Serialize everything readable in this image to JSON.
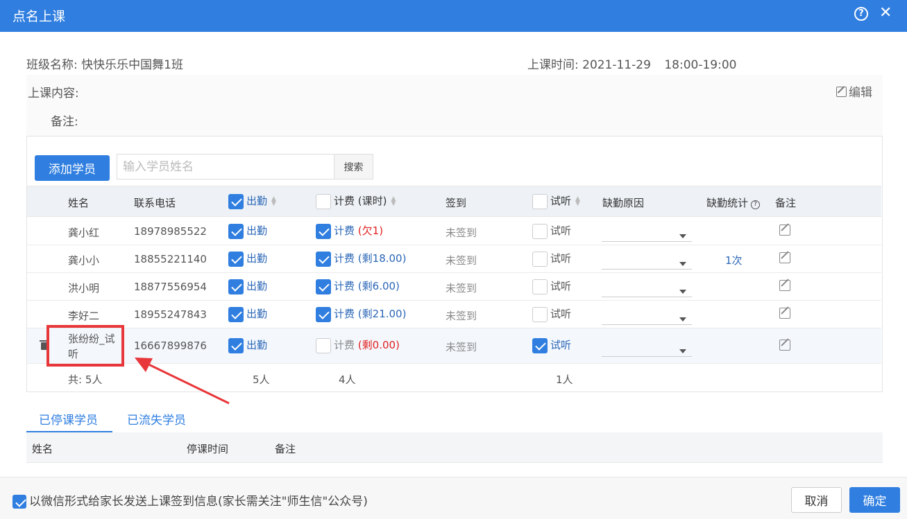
{
  "dialog": {
    "title": "点名上课",
    "help_icon": "question-circle-icon",
    "close_icon": "close-icon"
  },
  "info": {
    "class_label": "班级名称:",
    "class_name": "快快乐乐中国舞1班",
    "time_label": "上课时间:",
    "date": "2021-11-29",
    "time_range": "18:00-19:00",
    "content_label": "上课内容:",
    "remark_label": "备注:",
    "edit_label": "编辑"
  },
  "toolbar": {
    "add_label": "添加学员",
    "search_placeholder": "输入学员姓名",
    "search_label": "搜索"
  },
  "table": {
    "headers": {
      "name": "姓名",
      "phone": "联系电话",
      "attend": "出勤",
      "billing": "计费 (课时)",
      "checkin": "签到",
      "trial": "试听",
      "reason": "缺勤原因",
      "stats": "缺勤统计",
      "remark": "备注"
    },
    "rows": [
      {
        "name": "龚小红",
        "phone": "18978985522",
        "attend": true,
        "attend_label": "出勤",
        "bill": true,
        "bill_label": "计费",
        "bill_status": "(欠1)",
        "bill_red": true,
        "checkin": "未签到",
        "trial": false,
        "trial_label": "试听",
        "stats": ""
      },
      {
        "name": "龚小小",
        "phone": "18855221140",
        "attend": true,
        "attend_label": "出勤",
        "bill": true,
        "bill_label": "计费",
        "bill_status": "(剩18.00)",
        "bill_red": false,
        "checkin": "未签到",
        "trial": false,
        "trial_label": "试听",
        "stats": "1次"
      },
      {
        "name": "洪小明",
        "phone": "18877556954",
        "attend": true,
        "attend_label": "出勤",
        "bill": true,
        "bill_label": "计费",
        "bill_status": "(剩6.00)",
        "bill_red": false,
        "checkin": "未签到",
        "trial": false,
        "trial_label": "试听",
        "stats": ""
      },
      {
        "name": "李好二",
        "phone": "18955247843",
        "attend": true,
        "attend_label": "出勤",
        "bill": true,
        "bill_label": "计费",
        "bill_status": "(剩21.00)",
        "bill_red": false,
        "checkin": "未签到",
        "trial": false,
        "trial_label": "试听",
        "stats": ""
      },
      {
        "name_line1": "张纷纷_试",
        "name_line2": "听",
        "phone": "16667899876",
        "attend": true,
        "attend_label": "出勤",
        "bill": false,
        "bill_label": "计费",
        "bill_status": "(剩0.00)",
        "bill_red": true,
        "checkin": "未签到",
        "trial": true,
        "trial_label": "试听",
        "stats": ""
      }
    ],
    "summary": {
      "total": "共: 5人",
      "attend": "5人",
      "bill": "4人",
      "trial": "1人"
    }
  },
  "tabs": {
    "stopped": "已停课学员",
    "lost": "已流失学员"
  },
  "stopped_table": {
    "name": "姓名",
    "stop_time": "停课时间",
    "remark": "备注"
  },
  "footer": {
    "wechat_label": "以微信形式给家长发送上课签到信息(家长需关注\"师生信\"公众号)",
    "cancel": "取消",
    "ok": "确定"
  },
  "colors": {
    "primary": "#2f7ee0",
    "annotation": "#e8373a",
    "warn": "#e02020"
  }
}
